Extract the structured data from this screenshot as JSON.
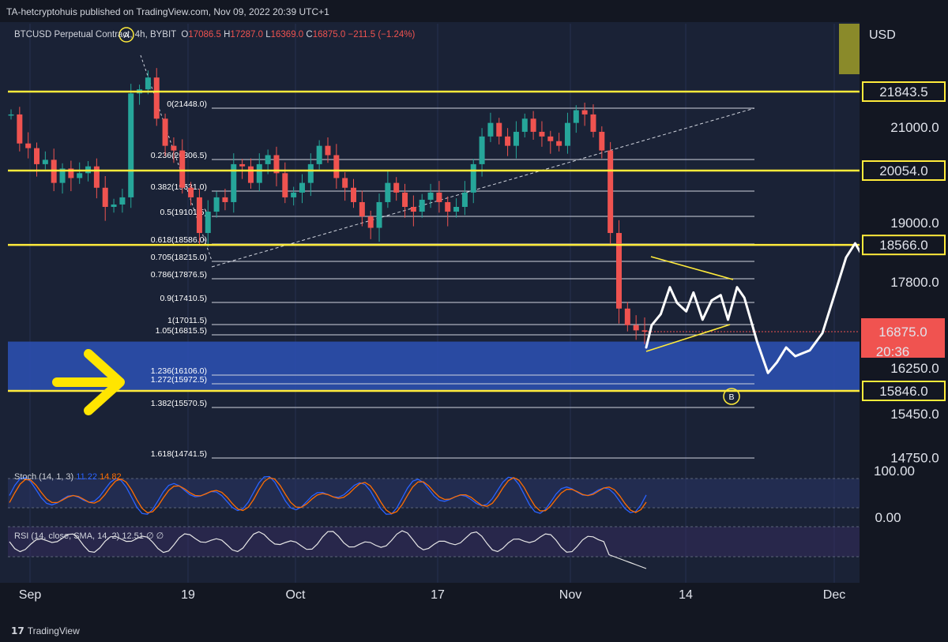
{
  "header": {
    "published": "TA-hetcryptohuis published on TradingView.com, Nov 09, 2022 20:39 UTC+1"
  },
  "legend": {
    "symbol": "BTCUSD Perpetual Contract",
    "timeframe": "4h",
    "exchange": "BYBIT",
    "o_label": "O",
    "o_value": "17086.5",
    "h_label": "H",
    "h_value": "17287.0",
    "l_label": "L",
    "l_value": "16369.0",
    "c_label": "C",
    "c_value": "16875.0",
    "change": "−211.5 (−1.24%)"
  },
  "currency": "USD",
  "indicators": {
    "stoch_label": "Stoch (14, 1, 3)",
    "stoch_k": "11.22",
    "stoch_d": "14.82",
    "rsi_label": "RSI (14, close, SMA, 14, 2)",
    "rsi_value": "12.51",
    "rsi_na1": "∅",
    "rsi_na2": "∅"
  },
  "colors": {
    "background": "#131722",
    "pane": "#1a2236",
    "up": "#26a69a",
    "down": "#ef5350",
    "level": "#ffeb3b",
    "zone": "#2b4fae",
    "price_tag": "#f05350"
  },
  "footer": {
    "brand": "TradingView",
    "brand_icon": "tradingview-logo-icon"
  },
  "chart_data": {
    "type": "candlestick",
    "symbol": "BTCUSD",
    "interval": "4h",
    "x_ticks": [
      "Sep",
      "19",
      "Oct",
      "17",
      "Nov",
      "14",
      "Dec"
    ],
    "y_ticks": [
      "21000.0",
      "19000.0",
      "17800.0",
      "16250.0",
      "15450.0",
      "14750.0"
    ],
    "ylim": [
      14500,
      22300
    ],
    "current_price": "16875.0",
    "countdown": "20:36",
    "horizontal_levels": [
      "21843.5",
      "20054.0",
      "18566.0",
      "15846.0"
    ],
    "fib_levels": [
      {
        "ratio": "0",
        "price": "21448.0"
      },
      {
        "ratio": "0.236",
        "price": "20306.5"
      },
      {
        "ratio": "0.382",
        "price": "19631.0"
      },
      {
        "ratio": "0.5",
        "price": "19101.5"
      },
      {
        "ratio": "0.618",
        "price": "18586.0"
      },
      {
        "ratio": "0.705",
        "price": "18215.0"
      },
      {
        "ratio": "0.786",
        "price": "17876.5"
      },
      {
        "ratio": "0.9",
        "price": "17410.5"
      },
      {
        "ratio": "1",
        "price": "17011.5"
      },
      {
        "ratio": "1.05",
        "price": "16815.5"
      },
      {
        "ratio": "1.236",
        "price": "16106.0"
      },
      {
        "ratio": "1.272",
        "price": "15972.5"
      },
      {
        "ratio": "1.382",
        "price": "15570.5"
      },
      {
        "ratio": "1.618",
        "price": "14741.5"
      }
    ],
    "support_zone": [
      "15846.0",
      "16700"
    ],
    "annotations": [
      "A",
      "B"
    ],
    "price_path": [
      21300,
      20650,
      20550,
      20200,
      20300,
      19800,
      20100,
      19900,
      20000,
      20150,
      19700,
      19300,
      19350,
      19500,
      21800,
      21900,
      22200,
      21200,
      20600,
      20500,
      19700,
      19500,
      18800,
      19200,
      19500,
      19400,
      20200,
      20150,
      19800,
      20200,
      20400,
      20000,
      19500,
      19600,
      19800,
      20200,
      20600,
      20400,
      19900,
      19700,
      19400,
      19100,
      18900,
      19400,
      19800,
      19600,
      19300,
      19200,
      19450,
      19600,
      19400,
      19200,
      19300,
      19600,
      20200,
      20800,
      21100,
      20800,
      20600,
      20900,
      21200,
      20900,
      20800,
      20700,
      20600,
      21100,
      21400,
      21300,
      20900,
      20500,
      18800,
      17300,
      17000,
      16900,
      16875
    ],
    "projection_path": [
      [
        16600,
        0
      ],
      [
        17000,
        3
      ],
      [
        17200,
        8
      ],
      [
        17700,
        13
      ],
      [
        17400,
        17
      ],
      [
        17250,
        22
      ],
      [
        17600,
        26
      ],
      [
        17100,
        31
      ],
      [
        17450,
        36
      ],
      [
        17550,
        41
      ],
      [
        17100,
        45
      ],
      [
        17700,
        50
      ],
      [
        17500,
        54
      ],
      [
        16700,
        61
      ],
      [
        16150,
        67
      ],
      [
        16350,
        72
      ],
      [
        16600,
        77
      ],
      [
        16450,
        82
      ],
      [
        16550,
        90
      ],
      [
        16850,
        97
      ],
      [
        17600,
        104
      ],
      [
        18300,
        110
      ],
      [
        18600,
        115
      ],
      [
        18200,
        121
      ],
      [
        17800,
        125
      ]
    ],
    "stoch": {
      "type": "line",
      "ylim": [
        0,
        100
      ],
      "ticks": [
        "100.00",
        "0.00"
      ]
    },
    "rsi": {
      "type": "line"
    }
  }
}
